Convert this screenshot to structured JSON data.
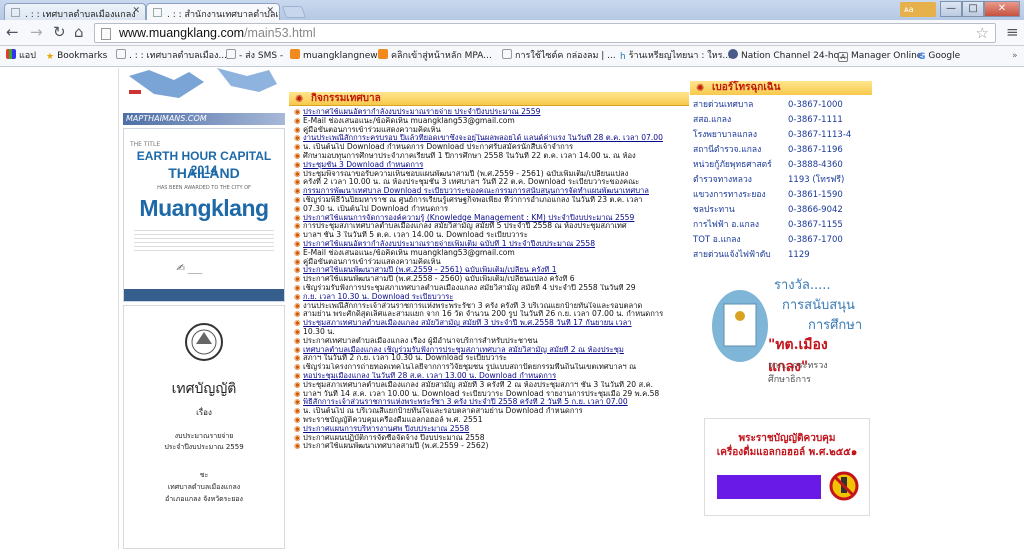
{
  "browser": {
    "tabs": [
      {
        "label": ". : : เทศบาลตำบลเมืองแกลง",
        "active": false
      },
      {
        "label": ". : : สำนักงานเทศบาลตำบลเ",
        "active": true
      }
    ],
    "profile_label": "ᴀa",
    "url_host": "www.muangklang.com",
    "url_path": "/main53.html",
    "bookmarks": [
      "แอป",
      "Bookmarks",
      ". : : เทศบาลตำบลเมือง...",
      "- ส่ง SMS -",
      "muangklangnews",
      "คลิกเข้าสู่หน้าหลัก MPA...",
      "การใช้ไซต์ค กล่องลม | ...",
      "ร้านเหรียญไทยนา : ใหร...",
      "Nation Channel 24-ho...",
      "Manager Online",
      "Google"
    ]
  },
  "left": {
    "logo_text": "MAPTHAIMANS.COM",
    "earth_hour": {
      "line1": "EARTH HOUR CAPITAL 2014",
      "line2": "THAILAND",
      "sub": "HAS BEEN AWARDED TO THE CITY OF",
      "city": "Muangklang"
    },
    "decree_title": "เทศบัญญัติ",
    "decree_items": [
      "เรื่อง",
      "งบประมาณรายจ่าย",
      "ประจำปีงบประมาณ 2559",
      "ชะ",
      "เทศบาลตำบลเมืองแกลง",
      "อำเภอแกลง จังหวัดระยอง"
    ]
  },
  "activities": {
    "header": "กิจกรรมเทศบาล",
    "items": [
      "ประกาศใช้แผนอัตรากำลังงบประมาณรายจ่าย ประจำปีงบประมาณ 2559",
      "E-Mail ช่องเสนอแนะ/ข้อคิดเห็น muangklang53@gmail.com",
      "คู่มือขั้นตอนการเข้าร่วมแสดงความคิดเห็น",
      "งานประเพณีสักการะครบรอบ ปีแล้วที่ยอดเขาซึ่งจะอยู่ในผลพลอยได้ แลนด์ค่าแรง ในวันที่ 28 ต.ค. เวลา 07.00",
      "น. เป็นต้นไป Download กำหนดการ Download ประกาศรับสมัครนักสืบเจ้าจำการ",
      "ศึกษามอบทุนการศึกษาประจำภาคเรียนที่ 1 ปีการศึกษา 2558 ในวันที่ 22 ต.ค. เวลา 14.00 น. ณ ห้อง",
      "ประชุมชั้น 3 Download กำหนดการ",
      "ประชุมพิจารณาขอรับความเห็นชอบแผนพัฒนาสามปี (พ.ศ.2559 - 2561) ฉบับเพิ่มเติม/เปลี่ยนแปลง",
      "ครั้งที่ 2 เวลา 10.00 น. ณ ห้องประชุมชั้น 3 เทศบาลฯ วันที่ 22 ต.ค. Download ระเบียบวาระของคณะ",
      "กรรมการพัฒนาเทศบาล Download ระเบียบวาระของคณะกรรมการสนับสนุนการจัดทำแผนพัฒนาเทศบาล",
      "เชิญร่วมพิธีวันปิยมหาราช ณ ศูนย์การเรียนรู้เศรษฐกิจพอเพียง ที่ว่าการอำเภอแกลง ในวันที่ 23 ต.ค. เวลา",
      "07.30 น. เป็นต้นไป Download กำหนดการ",
      "ประกาศใช้แผนการจัดการองค์ความรู้ (Knowledge Management : KM) ประจำปีงบประมาณ 2559",
      "การประชุมสภาเทศบาลตำบลเมืองแกลง สมัยวิสามัญ สมัยที่ 5 ประจำปี 2558 ณ ห้องประชุมสภาเทศ",
      "บาลฯ ชั้น 3 ในวันที่ 5 ต.ค. เวลา 14.00 น. Download ระเบียบวาระ",
      "ประกาศใช้แผนอัตรากำลังงบประมาณรายจ่ายเพิ่มเติม ฉบับที่ 1 ประจำปีงบประมาณ 2558",
      "E-Mail ช่องเสนอแนะ/ข้อคิดเห็น muangklang53@gmail.com",
      "คู่มือขั้นตอนการเข้าร่วมแสดงความคิดเห็น",
      "ประกาศใช้แผนพัฒนาสามปี (พ.ศ.2559 - 2561) ฉบับเพิ่มเติม/เปลี่ยน ครั้งที่ 1",
      "ประกาศใช้แผนพัฒนาสามปี (พ.ศ.2558 - 2560) ฉบับเพิ่มเติม/เปลี่ยนแปลง ครั้งที่ 6",
      "เชิญร่วมรับฟังการประชุมสภาเทศบาลตำบลเมืองแกลง สมัยวิสามัญ สมัยที่ 4 ประจำปี 2558 ในวันที่ 29",
      "ก.ย. เวลา 10.30 น. Download ระเบียบวาระ",
      "งานประเพณีสักการะเจ้าส่วนราชการแห่งพระพระรัชา 3 ครั้ง ครั้งที่ 3 บริเวณแยกป้ายทันใจและรอบตลาด",
      "สามย่าน พระศักดิ์สุดเลิศและสามแยก จาก 16 วัด จำนวน 200 รูป ในวันที่ 26 ก.ย. เวลา 07.00 น. กำหนดการ",
      "ประชุมสภาเทศบาลตำบลเมืองแกลง สมัยวิสามัญ สมัยที่ 3 ประจำปี พ.ศ.2558 วันที่ 17 กันยายน เวลา",
      "10.30 น.",
      "ประกาศเทศบาลตำบลเมืองแกลง เรื่อง ผู้มีอำนาจบริการสำหรับประชาชน",
      "เทศบาลตำบลเมืองแกลง เชิญร่วมรับฟังการประชุมสภาเทศบาล สมัยวิสามัญ สมัยที่ 2 ณ ห้องประชุม",
      "สภาฯ ในวันที่ 2 ก.ย. เวลา 10.30 น. Download ระเบียบวาระ",
      "เชิญร่วมโครงการถ่ายทอดเทคโนโลยีจากการวิจัยชุมชน รูปแบบสถาปัตยกรรมพื้นถิ่นในเขตเทศบาลฯ ณ",
      "หอประชุมเมืองแกลง ในวันที่ 28 ส.ค. เวลา 13.00 น. Download กำหนดการ",
      "ประชุมสภาเทศบาลตำบลเมืองแกลง สมัยสามัญ สมัยที่ 3 ครั้งที่ 2 ณ ห้องประชุมสภาฯ ชั้น 3 ในวันที่ 20 ส.ค.",
      "บาลฯ วันที่ 14 ส.ค. เวลา 10.00 น. Download ระเบียบวาระ Download รายงานการประชุมเมื่อ 29 พ.ค.58",
      "พิธีสักการะเจ้าส่วนราชการแห่งพระพระรัชา 3 ครั้ง ประจำปี 2558 ครั้งที่ 2 วันที่ 5 ก.ย. เวลา 07.00",
      "น. เป็นต้นไป ณ บริเวณสี่แยกป้ายทันใจและรอบตลาดสามย่าน Download กำหนดการ",
      "พระราชบัญญัติควบคุมเครื่องดื่มแอลกอฮอล์ พ.ศ. 2551",
      "ประกาศแผนการบริหารงานศพ ปีงบประมาณ 2558",
      "ประกาศแผนปฏิบัติการจัดซื้อจัดจ้าง ปีงบประมาณ 2558",
      "ประกาศใช้แผนพัฒนาเทศบาลสามปี (พ.ศ.2559 - 2562)"
    ]
  },
  "emergency": {
    "header": "เบอร์โทรฉุกเฉิน",
    "rows": [
      {
        "name": "สายด่วนเทศบาล",
        "phone": "0-3867-1000"
      },
      {
        "name": "สสอ.แกลง",
        "phone": "0-3867-1111"
      },
      {
        "name": "โรงพยาบาลแกลง",
        "phone": "0-3867-1113-4"
      },
      {
        "name": "สถานีตำรวจ.แกลง",
        "phone": "0-3867-1196"
      },
      {
        "name": "หน่วยกู้ภัยพุทธศาสตร์",
        "phone": "0-3888-4360"
      },
      {
        "name": "ตำรวจทางหลวง",
        "phone": "1193 (โทรฟรี)"
      },
      {
        "name": "แขวงการทางระยอง",
        "phone": "0-3861-1590"
      },
      {
        "name": "ชลประทาน",
        "phone": "0-3866-9042"
      },
      {
        "name": "การไฟฟ้า อ.แกลง",
        "phone": "0-3867-1155"
      },
      {
        "name": "TOT อ.แกลง",
        "phone": "0-3867-1700"
      },
      {
        "name": "สายด่วนแจ้งไฟฟ้าดับ",
        "phone": "1129"
      }
    ]
  },
  "award": {
    "line1": "รางวัล.....",
    "line2": "การสนับสนุน",
    "line3": "การศึกษา",
    "line4": "\"ทต.เมืองแกลง\"",
    "line5": "จาก...กระทรวงศึกษาธิการ"
  },
  "alcohol_law": {
    "line1": "พระราชบัญญัติควบคุม",
    "line2": "เครื่องดื่มแอลกอฮอล์ พ.ศ.๒๕๕๑"
  }
}
